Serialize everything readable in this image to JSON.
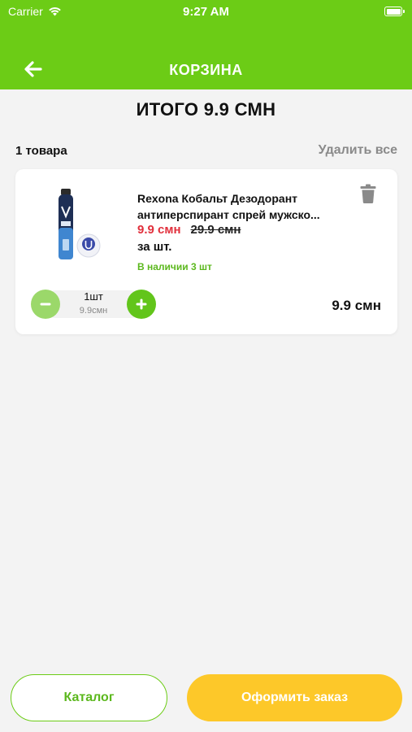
{
  "status_bar": {
    "carrier": "Carrier",
    "time": "9:27 AM"
  },
  "nav": {
    "title": "КОРЗИНА"
  },
  "summary": {
    "total_title": "ИТОГО 9.9 СМН",
    "items_count": "1 товара",
    "delete_all": "Удалить все"
  },
  "cart_items": [
    {
      "name_line1": "Rexona Кобальт Дезодорант",
      "name_line2": "антиперспирант спрей мужско...",
      "price_new": "9.9 смн",
      "price_old": "29.9 смн",
      "per_unit": "за шт.",
      "stock": "В наличии 3 шт",
      "quantity": "1шт",
      "quantity_price": "9.9смн",
      "line_total": "9.9 смн"
    }
  ],
  "buttons": {
    "catalog": "Каталог",
    "checkout": "Оформить заказ"
  },
  "colors": {
    "brand_green": "#6ccc16",
    "price_red": "#e1303c",
    "checkout_yellow": "#fdc829",
    "stock_green": "#5cb81e"
  }
}
